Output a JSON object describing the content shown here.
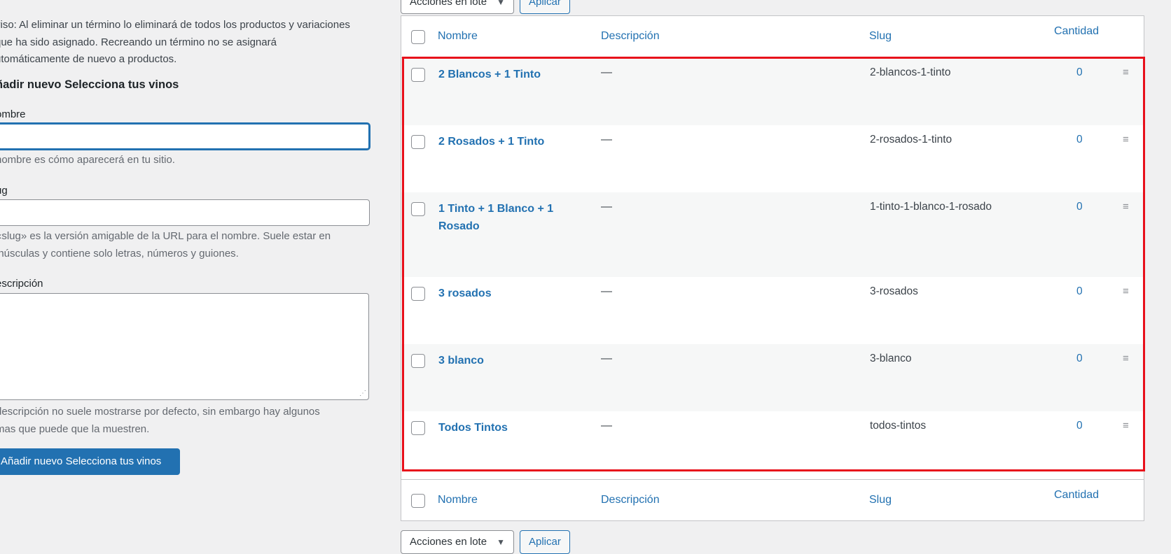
{
  "bulk_actions": {
    "select_label": "Acciones en lote",
    "apply_label": "Aplicar"
  },
  "form": {
    "notice": "Aviso: Al eliminar un término lo eliminará de todos los productos y variaciones a que ha sido asignado. Recreando un término no se asignará automáticamente de nuevo a productos.",
    "notice_lines": [
      "viso: Al eliminar un término lo eliminará de todos los productos y variaciones",
      "que ha sido asignado. Recreando un término no se asignará",
      "utomáticamente de nuevo a productos."
    ],
    "title": "ñadir nuevo Selecciona tus vinos",
    "name_label": "ombre",
    "name_value": "",
    "name_help": "nombre es cómo aparecerá en tu sitio.",
    "slug_label": "ug",
    "slug_value": "",
    "slug_help_lines": [
      "«slug» es la versión amigable de la URL para el nombre. Suele estar en",
      "inúsculas y contiene solo letras, números y guiones."
    ],
    "desc_label": "escripción",
    "desc_value": "",
    "desc_help_lines": [
      "descripción no suele mostrarse por defecto, sin embargo hay algunos",
      "mas que puede que la muestren."
    ],
    "submit_label": "Añadir nuevo Selecciona tus vinos"
  },
  "table": {
    "columns": {
      "name": "Nombre",
      "description": "Descripción",
      "slug": "Slug",
      "count": "Cantidad"
    },
    "rows": [
      {
        "name": "2 Blancos + 1 Tinto",
        "description": "—",
        "slug": "2-blancos-1-tinto",
        "count": "0"
      },
      {
        "name": "2 Rosados + 1 Tinto",
        "description": "—",
        "slug": "2-rosados-1-tinto",
        "count": "0"
      },
      {
        "name": "1 Tinto + 1 Blanco + 1 Rosado",
        "description": "—",
        "slug": "1-tinto-1-blanco-1-rosado",
        "count": "0"
      },
      {
        "name": "3 rosados",
        "description": "—",
        "slug": "3-rosados",
        "count": "0"
      },
      {
        "name": "3 blanco",
        "description": "—",
        "slug": "3-blanco",
        "count": "0"
      },
      {
        "name": "Todos Tintos",
        "description": "—",
        "slug": "todos-tintos",
        "count": "0"
      }
    ],
    "drag_icon": "≡"
  },
  "colors": {
    "link": "#2271b1",
    "highlight": "#e8101b",
    "primary": "#2271b1"
  }
}
